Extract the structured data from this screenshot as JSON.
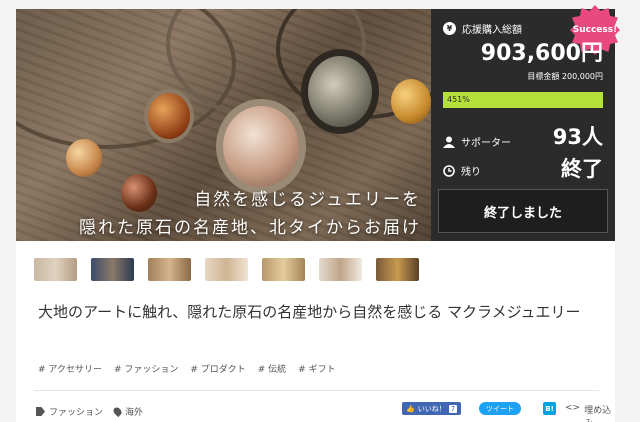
{
  "hero": {
    "caption_line1": "自然を感じるジュエリーを",
    "caption_line2": "隠れた原石の名産地、北タイからお届け"
  },
  "stats": {
    "success_badge": "Success!",
    "funding_label": "応援購入総額",
    "funding_amount": "903,600円",
    "goal_text": "目標金額 200,000円",
    "progress_percent": 451,
    "progress_label": "451%",
    "supporters_label": "サポーター",
    "supporters_value": "93人",
    "remaining_label": "残り",
    "remaining_value": "終了",
    "finished_button": "終了しました"
  },
  "project": {
    "title": "大地のアートに触れ、隠れた原石の名産地から自然を感じる マクラメジュエリー",
    "tags": [
      "# アクセサリー",
      "# ファッション",
      "# プロダクト",
      "# 伝統",
      "# ギフト"
    ],
    "category": "ファッション",
    "location": "海外"
  },
  "share": {
    "facebook_label": "いいね！",
    "facebook_count": "7",
    "twitter_label": "ツイート",
    "hatena_label": "B!",
    "embed_label": "埋め込み"
  },
  "colors": {
    "panel_bg": "#2b2b2b",
    "progress": "#b5e23a",
    "success_badge": "#e84a7f",
    "facebook": "#4267b2",
    "twitter": "#1da1f2",
    "hatena": "#00a4de"
  },
  "thumbnail_count": 7
}
